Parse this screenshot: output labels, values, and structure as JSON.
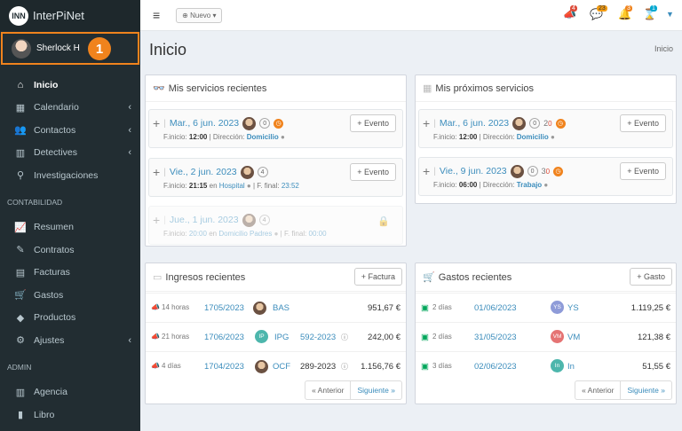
{
  "app": {
    "name": "InterPiNet",
    "logo_text": "INN"
  },
  "user": {
    "name": "Sherlock H",
    "step_badge": "1"
  },
  "sidebar": {
    "items": [
      {
        "label": "Inicio",
        "icon": "home-icon",
        "active": true
      },
      {
        "label": "Calendario",
        "icon": "calendar-icon",
        "chevron": true
      },
      {
        "label": "Contactos",
        "icon": "users-icon",
        "chevron": true
      },
      {
        "label": "Detectives",
        "icon": "building-icon",
        "chevron": true
      },
      {
        "label": "Investigaciones",
        "icon": "search-icon"
      }
    ],
    "section_contabilidad": "CONTABILIDAD",
    "contabilidad_items": [
      {
        "label": "Resumen",
        "icon": "chart-icon"
      },
      {
        "label": "Contratos",
        "icon": "contract-icon"
      },
      {
        "label": "Facturas",
        "icon": "invoice-icon"
      },
      {
        "label": "Gastos",
        "icon": "cart-icon"
      },
      {
        "label": "Productos",
        "icon": "tag-icon"
      },
      {
        "label": "Ajustes",
        "icon": "cogs-icon",
        "chevron": true
      }
    ],
    "section_admin": "ADMIN",
    "admin_items": [
      {
        "label": "Agencia",
        "icon": "building-icon"
      },
      {
        "label": "Libro",
        "icon": "book-icon"
      }
    ]
  },
  "topbar": {
    "new_button": "Nuevo",
    "badges": [
      {
        "icon": "megaphone-icon",
        "count": "4",
        "color": "#dd4b39"
      },
      {
        "icon": "comments-icon",
        "count": "23",
        "color": "#f39c12"
      },
      {
        "icon": "bell-icon",
        "count": "3",
        "color": "#f0831d"
      },
      {
        "icon": "hourglass-icon",
        "count": "1",
        "color": "#00a7d0"
      }
    ]
  },
  "page": {
    "title": "Inicio",
    "breadcrumb": "Inicio"
  },
  "recent_services": {
    "title": "Mis servicios recientes",
    "items": [
      {
        "date": "Mar., 6 jun. 2023",
        "count": "0",
        "start_label": "F.inicio:",
        "start": "12:00",
        "sep": "Dirección:",
        "place": "Domicilio",
        "button": "Evento"
      },
      {
        "date": "Vie., 2 jun. 2023",
        "count": "4",
        "start_label": "F.inicio:",
        "start": "21:15",
        "sep": "en",
        "place": "Hospital",
        "end_label": "F. final:",
        "end": "23:52",
        "button": "Evento"
      },
      {
        "date": "Jue., 1 jun. 2023",
        "count": "4",
        "start_label": "F.inicio:",
        "start": "20:00",
        "sep": "en",
        "place": "Domicilio Padres",
        "end_label": "F. final:",
        "end": "00:00"
      }
    ]
  },
  "upcoming_services": {
    "title": "Mis próximos servicios",
    "items": [
      {
        "date": "Mar., 6 jun. 2023",
        "count": "0",
        "extra": "2",
        "extra2": "0",
        "start_label": "F.inicio:",
        "start": "12:00",
        "sep": "Dirección:",
        "place": "Domicilio",
        "button": "Evento"
      },
      {
        "date": "Vie., 9 jun. 2023",
        "count": "0",
        "extra": "3",
        "extra2": "0",
        "start_label": "F.inicio:",
        "start": "06:00",
        "sep": "Dirección:",
        "place": "Trabajo",
        "button": "Evento"
      }
    ]
  },
  "income": {
    "title": "Ingresos recientes",
    "button": "Factura",
    "rows": [
      {
        "time": "14 horas",
        "id": "1705/2023",
        "client": "BAS",
        "amount": "951,67 €"
      },
      {
        "time": "21 horas",
        "id": "1706/2023",
        "initials": "IP",
        "client": "IPG",
        "ref": "592-2023",
        "amount": "242,00 €"
      },
      {
        "time": "4 días",
        "id": "1704/2023",
        "client": "OCF",
        "ref": "289-2023",
        "amount": "1.156,76 €"
      }
    ],
    "prev": "« Anterior",
    "next": "Siguiente »"
  },
  "expenses": {
    "title": "Gastos recientes",
    "button": "Gasto",
    "rows": [
      {
        "time": "2 días",
        "date": "01/06/2023",
        "initials": "YS",
        "client": "YS",
        "color": "#8e9bd8",
        "amount": "1.119,25 €"
      },
      {
        "time": "2 días",
        "date": "31/05/2023",
        "initials": "VM",
        "client": "VM",
        "color": "#e57373",
        "amount": "121,38 €"
      },
      {
        "time": "3 días",
        "date": "02/06/2023",
        "initials": "In",
        "client": "In",
        "color": "#4db6ac",
        "amount": "51,55 €"
      }
    ],
    "prev": "« Anterior",
    "next": "Siguiente »"
  }
}
